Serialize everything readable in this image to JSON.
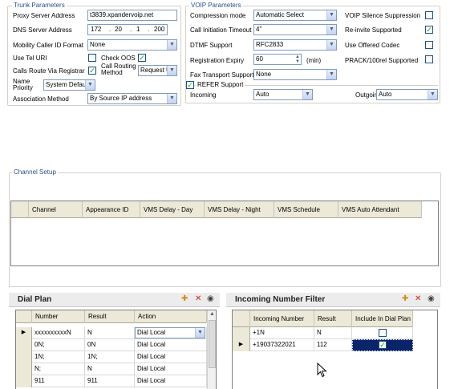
{
  "trunk": {
    "title": "Trunk Parameters",
    "proxy_label": "Proxy Server Address",
    "proxy_value": "t3839.xpandervoip.net",
    "dns_label": "DNS Server Address",
    "dns_octets": [
      "172",
      "20",
      "1",
      "200"
    ],
    "mobility_label": "Mobility Caller ID Format",
    "mobility_value": "None",
    "tel_uri_label": "Use Tel URI",
    "check_oos_label": "Check OOS",
    "calls_route_label": "Calls Route Via Registrar",
    "call_routing_label": "Call Routing Method",
    "call_routing_value": "Request U",
    "name_priority_label": "Name Priority",
    "name_priority_value": "System Default",
    "assoc_label": "Association Method",
    "assoc_value": "By Source IP address"
  },
  "voip": {
    "title": "VOIP Parameters",
    "compression_label": "Compression mode",
    "compression_value": "Automatic Select",
    "silence_label": "VOIP Silence Suppression",
    "call_init_label": "Call Initiation Timeout",
    "call_init_value": "4\"",
    "reinvite_label": "Re-invite Supported",
    "dtmf_label": "DTMF Support",
    "dtmf_value": "RFC2833",
    "offered_codec_label": "Use Offered Codec",
    "reg_expiry_label": "Registration Expiry",
    "reg_expiry_value": "60",
    "reg_expiry_unit": "(min)",
    "prack_label": "PRACK/100rel Supported",
    "fax_label": "Fax Transport Support",
    "fax_value": "None",
    "refer_label": "REFER Support",
    "incoming_label": "Incoming",
    "incoming_value": "Auto",
    "outgoing_label": "Outgoing",
    "outgoing_value": "Auto"
  },
  "channel": {
    "title": "Channel Setup",
    "columns": [
      "Channel",
      "Appearance ID",
      "VMS Delay - Day",
      "VMS Delay - Night",
      "VMS Schedule",
      "VMS Auto Attendant"
    ]
  },
  "dial_plan": {
    "title": "Dial Plan",
    "columns": [
      "Number",
      "Result",
      "Action"
    ],
    "rows": [
      {
        "number": "xxxxxxxxxxN",
        "result": "N",
        "action": "Dial Local"
      },
      {
        "number": "0N;",
        "result": "0N",
        "action": "Dial Local"
      },
      {
        "number": "1N;",
        "result": "1N;",
        "action": "Dial Local"
      },
      {
        "number": "N;",
        "result": "N",
        "action": "Dial Local"
      },
      {
        "number": "911",
        "result": "911",
        "action": "Dial Local"
      }
    ]
  },
  "incoming_filter": {
    "title": "Incoming Number Filter",
    "columns": [
      "Incoming Number",
      "Result",
      "Include In Dial Plan"
    ],
    "rows": [
      {
        "number": "+1N",
        "result": "N"
      },
      {
        "number": "+19037322021",
        "result": "112"
      }
    ]
  },
  "icons": {
    "add": "add-icon",
    "delete": "delete-icon",
    "view": "view-icon"
  }
}
